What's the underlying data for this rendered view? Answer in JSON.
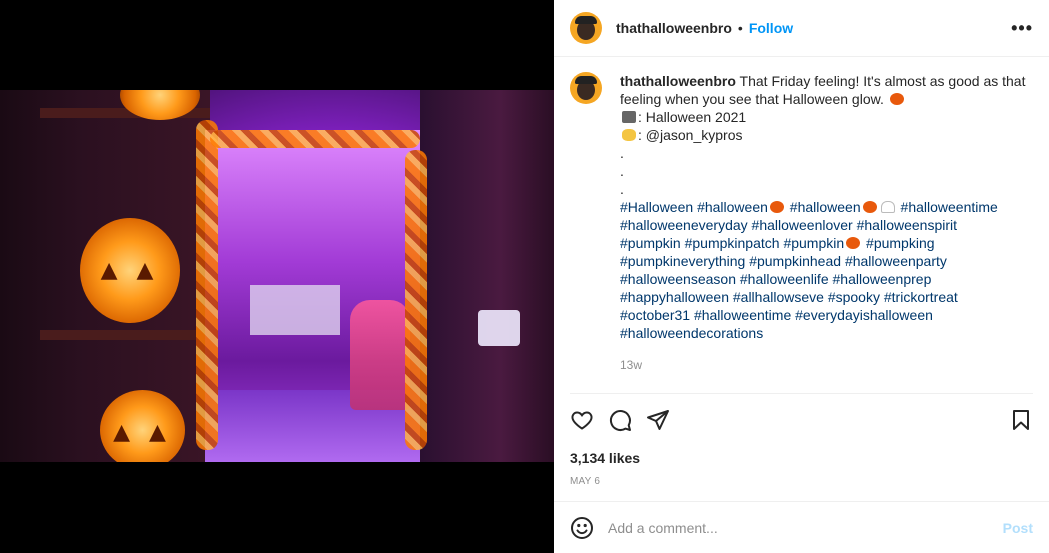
{
  "post": {
    "username": "thathalloweenbro",
    "separator": "•",
    "follow_label": "Follow",
    "more_label": "•••",
    "caption": {
      "username": "thathalloweenbro",
      "line1": "That Friday feeling! It's almost as good as that feeling when you see that Halloween glow.",
      "line2": ": Halloween 2021",
      "line3": ": @jason_kypros",
      "dots": [
        ".",
        ".",
        "."
      ],
      "hashtags_lines": [
        [
          "#Halloween",
          "#halloween",
          "#halloween",
          "#halloweentime"
        ],
        [
          "#halloweeneveryday",
          "#halloweenlover",
          "#halloweenspirit"
        ],
        [
          "#pumpkin",
          "#pumpkinpatch",
          "#pumpkin",
          "#pumpking"
        ],
        [
          "#pumpkineverything",
          "#pumpkinhead",
          "#halloweenparty"
        ],
        [
          "#halloweenseason",
          "#halloweenlife",
          "#halloweenprep"
        ],
        [
          "#happyhalloween",
          "#allhallowseve",
          "#spooky",
          "#trickortreat"
        ],
        [
          "#october31",
          "#halloweentime",
          "#everydayishalloween"
        ],
        [
          "#halloweendecorations"
        ]
      ]
    },
    "timestamp": "13w",
    "likes": "3,134 likes",
    "date": "MAY 6",
    "comment_placeholder": "Add a comment...",
    "post_label": "Post"
  },
  "icons": {
    "like": "heart-icon",
    "comment": "comment-icon",
    "share": "paper-plane-icon",
    "save": "bookmark-icon",
    "emoji": "smiley-icon",
    "more": "more-options-icon"
  },
  "colors": {
    "link": "#0095f6",
    "hashtag": "#00376b",
    "muted": "#8e8e8e",
    "post_disabled": "#b2dffc",
    "avatar_bg": "#f5a623"
  }
}
